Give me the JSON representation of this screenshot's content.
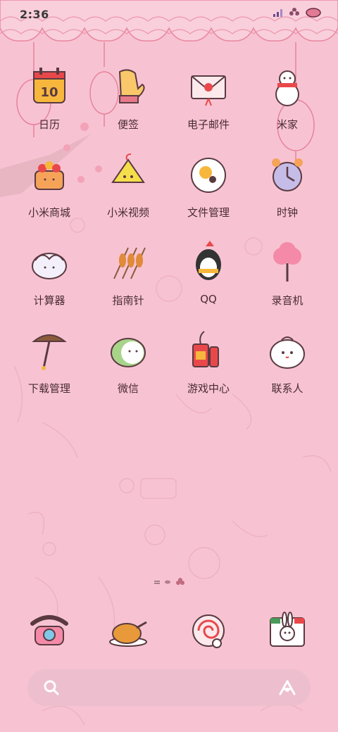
{
  "status_bar": {
    "time": "2:36"
  },
  "apps": [
    {
      "label": "日历",
      "icon": "calendar-icon",
      "calendar_day": "10"
    },
    {
      "label": "便签",
      "icon": "mitten-icon"
    },
    {
      "label": "电子邮件",
      "icon": "envelope-icon"
    },
    {
      "label": "米家",
      "icon": "snowman-icon"
    },
    {
      "label": "小米商城",
      "icon": "cake-icon"
    },
    {
      "label": "小米视频",
      "icon": "zongzi-icon"
    },
    {
      "label": "文件管理",
      "icon": "plate-icon"
    },
    {
      "label": "时钟",
      "icon": "alarm-clock-icon"
    },
    {
      "label": "计算器",
      "icon": "dumpling-icon"
    },
    {
      "label": "指南针",
      "icon": "skewers-icon"
    },
    {
      "label": "QQ",
      "icon": "penguin-icon"
    },
    {
      "label": "录音机",
      "icon": "cotton-candy-icon"
    },
    {
      "label": "下载管理",
      "icon": "mushroom-icon"
    },
    {
      "label": "微信",
      "icon": "green-bun-icon"
    },
    {
      "label": "游戏中心",
      "icon": "firecracker-icon"
    },
    {
      "label": "联系人",
      "icon": "white-bun-icon"
    }
  ],
  "dock": [
    {
      "icon": "telephone-icon"
    },
    {
      "icon": "roast-chicken-icon"
    },
    {
      "icon": "swiss-roll-icon"
    },
    {
      "icon": "bunny-camera-icon"
    }
  ],
  "search": {
    "icon": "search-icon",
    "assistant_icon": "assistant-icon"
  }
}
